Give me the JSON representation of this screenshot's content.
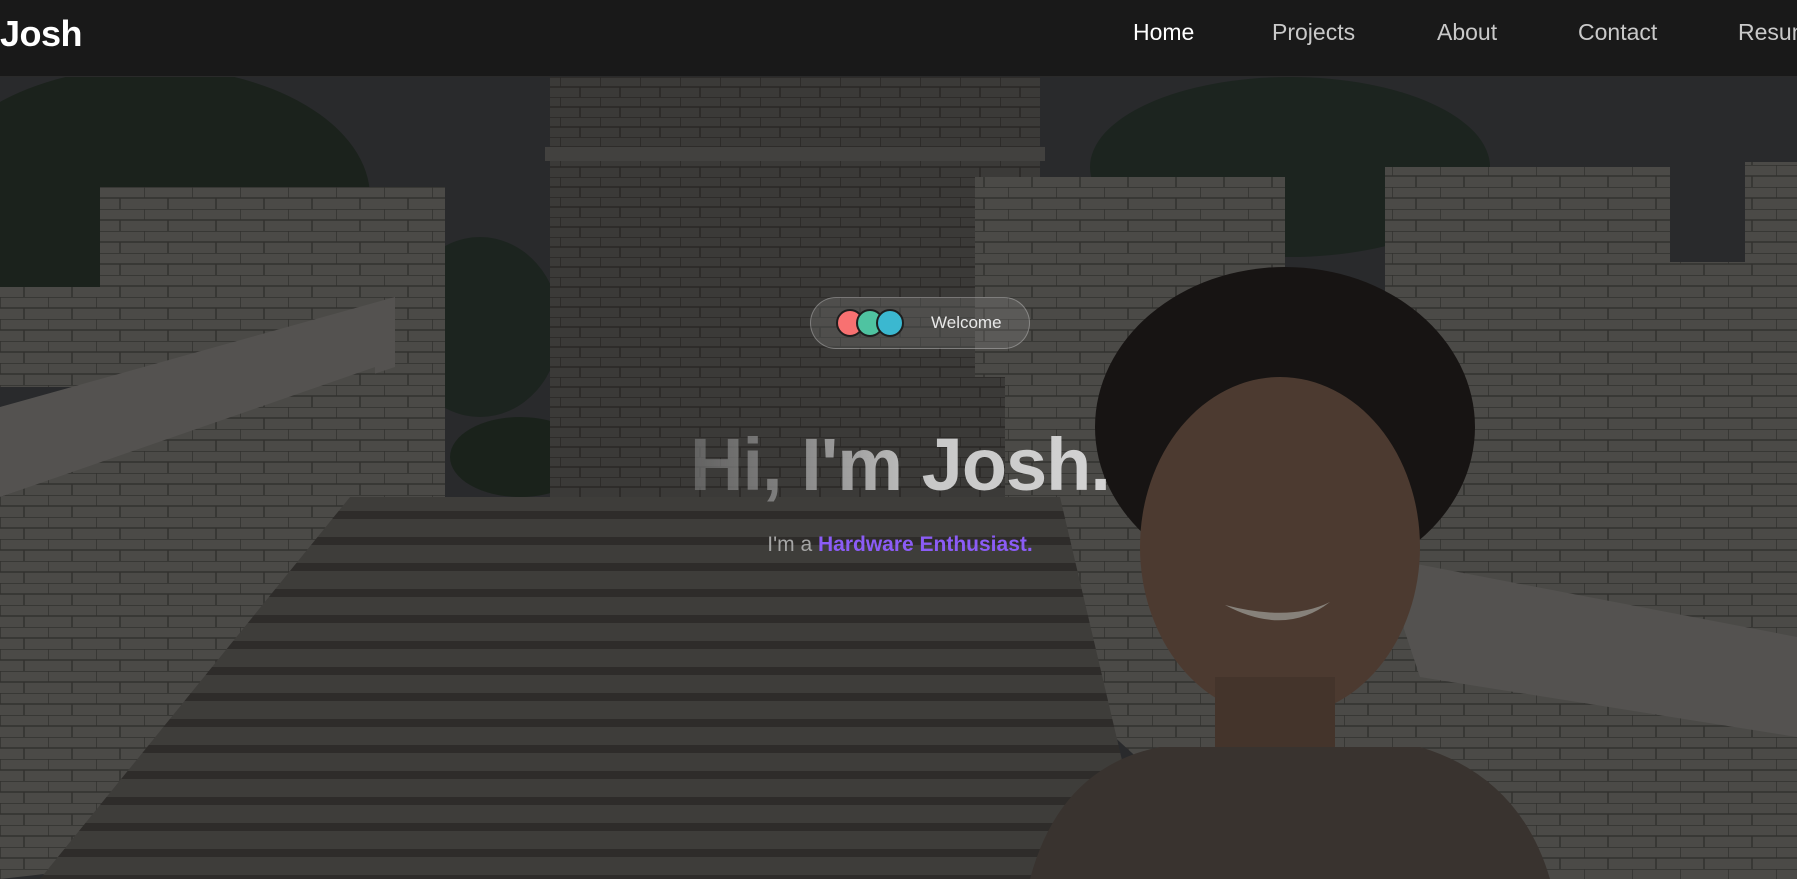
{
  "nav": {
    "brand": "Josh",
    "links": [
      {
        "label": "Home",
        "active": true
      },
      {
        "label": "Projects",
        "active": false
      },
      {
        "label": "About",
        "active": false
      },
      {
        "label": "Contact",
        "active": false
      },
      {
        "label": "Resume",
        "active": false
      }
    ]
  },
  "hero": {
    "badge": {
      "label": "Welcome",
      "dot_colors": [
        "#f87171",
        "#4fc3a1",
        "#3bb8d0"
      ]
    },
    "title": "Hi, I'm Josh.",
    "subtitle_prefix": "I'm a",
    "subtitle_role": "Hardware Enthusiast.",
    "accent_color": "#8b5cf6",
    "background_icon": "great-wall-selfie-photo"
  }
}
